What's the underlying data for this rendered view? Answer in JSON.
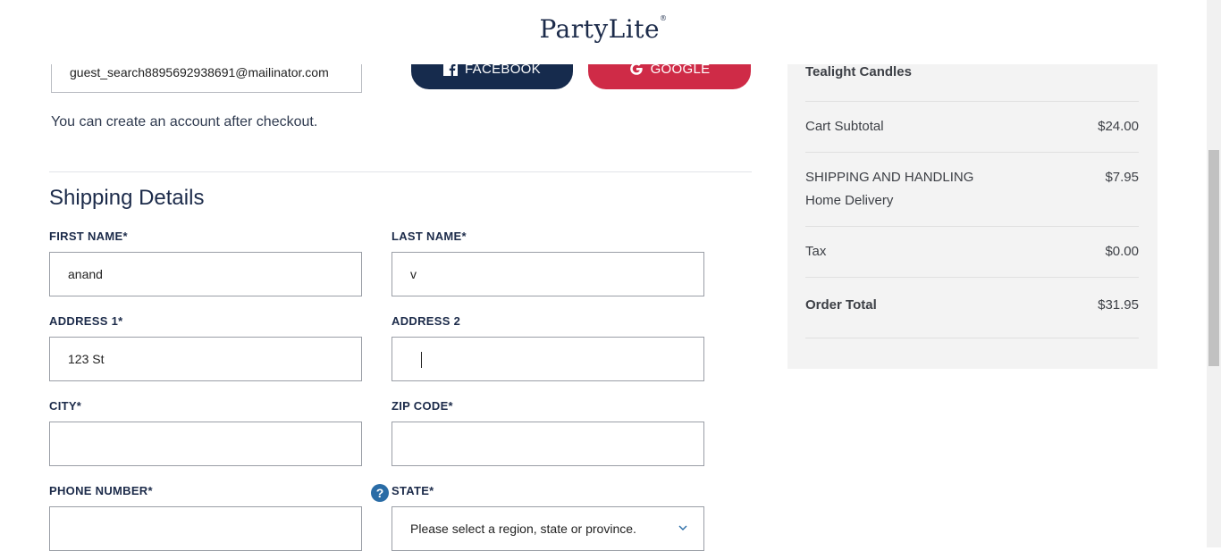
{
  "header": {
    "logo_text": "PartyLite",
    "logo_mark": "®"
  },
  "guest": {
    "email_value": "guest_search8895692938691@mailinator.com",
    "create_account_note": "You can create an account after checkout.",
    "facebook_label": "FACEBOOK",
    "google_label": "GOOGLE"
  },
  "shipping": {
    "title": "Shipping Details",
    "first_name": {
      "label": "FIRST NAME*",
      "value": "anand"
    },
    "last_name": {
      "label": "LAST NAME*",
      "value": "v"
    },
    "address1": {
      "label": "ADDRESS 1*",
      "value": "123 St"
    },
    "address2": {
      "label": "ADDRESS 2",
      "value": ""
    },
    "city": {
      "label": "CITY*",
      "value": ""
    },
    "zip": {
      "label": "ZIP CODE*",
      "value": ""
    },
    "phone": {
      "label": "PHONE NUMBER*",
      "value": ""
    },
    "state": {
      "label": "STATE*",
      "placeholder": "Please select a region, state or province."
    },
    "help_glyph": "?"
  },
  "summary": {
    "item_name": "Tealight Candles",
    "subtotal_label": "Cart Subtotal",
    "subtotal_value": "$24.00",
    "shipping_label": "SHIPPING AND HANDLING",
    "shipping_method": "Home Delivery",
    "shipping_value": "$7.95",
    "tax_label": "Tax",
    "tax_value": "$0.00",
    "total_label": "Order Total",
    "total_value": "$31.95"
  },
  "colors": {
    "brand_navy": "#162b4d",
    "google_red": "#cf2b47",
    "help_blue": "#2a6ca6"
  }
}
